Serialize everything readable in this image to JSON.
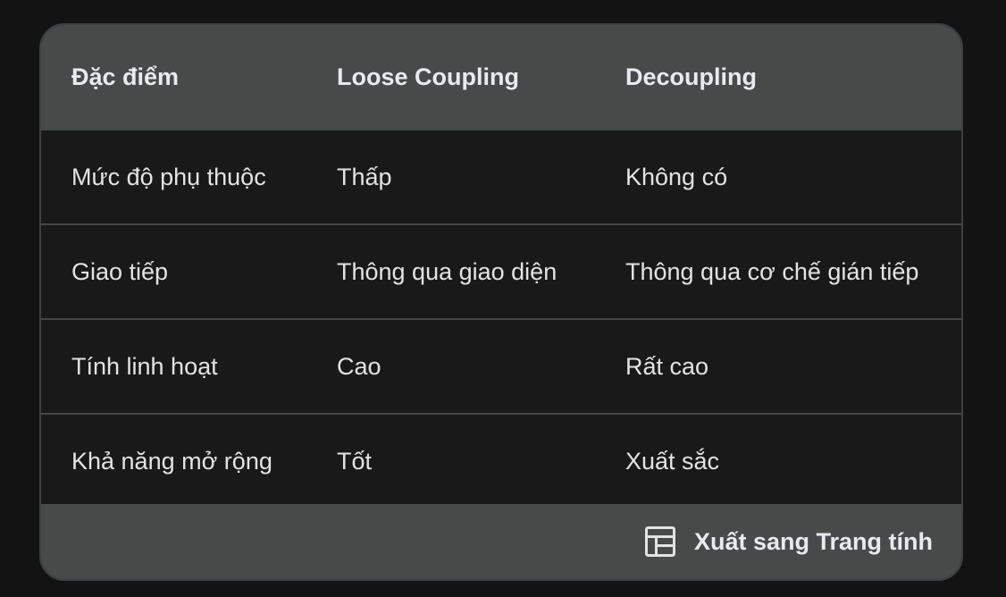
{
  "table": {
    "headers": [
      "Đặc điểm",
      "Loose Coupling",
      "Decoupling"
    ],
    "rows": [
      [
        "Mức độ phụ thuộc",
        "Thấp",
        "Không có"
      ],
      [
        "Giao tiếp",
        "Thông qua giao diện",
        "Thông qua cơ chế gián tiếp"
      ],
      [
        "Tính linh hoạt",
        "Cao",
        "Rất cao"
      ],
      [
        "Khả năng mở rộng",
        "Tốt",
        "Xuất sắc"
      ]
    ]
  },
  "footer": {
    "export_label": "Xuất sang Trang tính",
    "export_icon": "table-icon"
  },
  "colors": {
    "page_background": "#131314",
    "header_background": "#474a49",
    "row_background": "#191919",
    "text": "#e3e3e3"
  }
}
